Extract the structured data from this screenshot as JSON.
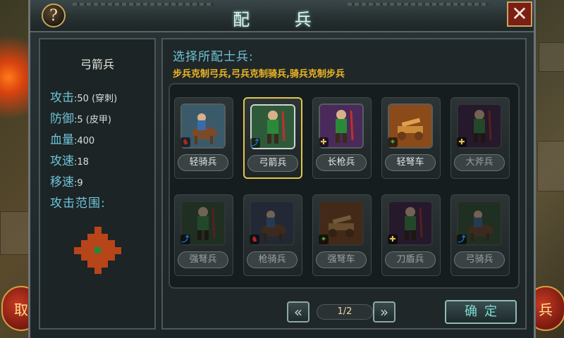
{
  "dialog": {
    "title": "配 兵",
    "help_label": "?",
    "close_label": "✕"
  },
  "side_buttons": {
    "left_label": "取",
    "right_label": "兵"
  },
  "info": {
    "unit_name": "弓箭兵",
    "stats": [
      {
        "key": "攻击",
        "sep": ":",
        "value": "50 (穿刺)"
      },
      {
        "key": "防御",
        "sep": ":",
        "value": "5 (皮甲)"
      },
      {
        "key": "血量",
        "sep": ":",
        "value": "400"
      },
      {
        "key": "攻速",
        "sep": ":",
        "value": "18"
      },
      {
        "key": "移速",
        "sep": ":",
        "value": "9"
      }
    ],
    "range_label": "攻击范围:",
    "range_center_color": "#1e8a3a",
    "range_cell_color": "#b8441a"
  },
  "panel": {
    "prompt": "选择所配士兵:",
    "rule": "步兵克制弓兵,弓兵克制骑兵,骑兵克制步兵"
  },
  "units": [
    {
      "name": "轻骑兵",
      "tag": "horse",
      "tag_color": "#c0241c",
      "enabled": true,
      "selected": false,
      "icon": "cavalry-icon"
    },
    {
      "name": "弓箭兵",
      "tag": "bow",
      "tag_color": "#2a6fd0",
      "enabled": true,
      "selected": true,
      "icon": "archer-icon"
    },
    {
      "name": "长枪兵",
      "tag": "foot",
      "tag_color": "#e0c050",
      "enabled": true,
      "selected": false,
      "icon": "spearman-icon"
    },
    {
      "name": "轻弩车",
      "tag": "siege",
      "tag_color": "#3cae4a",
      "enabled": true,
      "selected": false,
      "icon": "ballista-icon"
    },
    {
      "name": "大斧兵",
      "tag": "foot",
      "tag_color": "#e0c050",
      "enabled": false,
      "selected": false,
      "icon": "axeman-icon"
    },
    {
      "name": "强弩兵",
      "tag": "bow",
      "tag_color": "#2a6fd0",
      "enabled": false,
      "selected": false,
      "icon": "crossbowman-icon"
    },
    {
      "name": "枪骑兵",
      "tag": "horse",
      "tag_color": "#c0241c",
      "enabled": false,
      "selected": false,
      "icon": "lancer-icon"
    },
    {
      "name": "强弩车",
      "tag": "siege",
      "tag_color": "#3cae4a",
      "enabled": false,
      "selected": false,
      "icon": "heavy-ballista-icon"
    },
    {
      "name": "刀盾兵",
      "tag": "foot",
      "tag_color": "#e0c050",
      "enabled": false,
      "selected": false,
      "icon": "sword-shield-icon"
    },
    {
      "name": "弓骑兵",
      "tag": "bow",
      "tag_color": "#2a6fd0",
      "enabled": false,
      "selected": false,
      "icon": "horse-archer-icon"
    }
  ],
  "pager": {
    "prev_label": "«",
    "next_label": "»",
    "indicator": "1/2"
  },
  "confirm_label": "确定"
}
